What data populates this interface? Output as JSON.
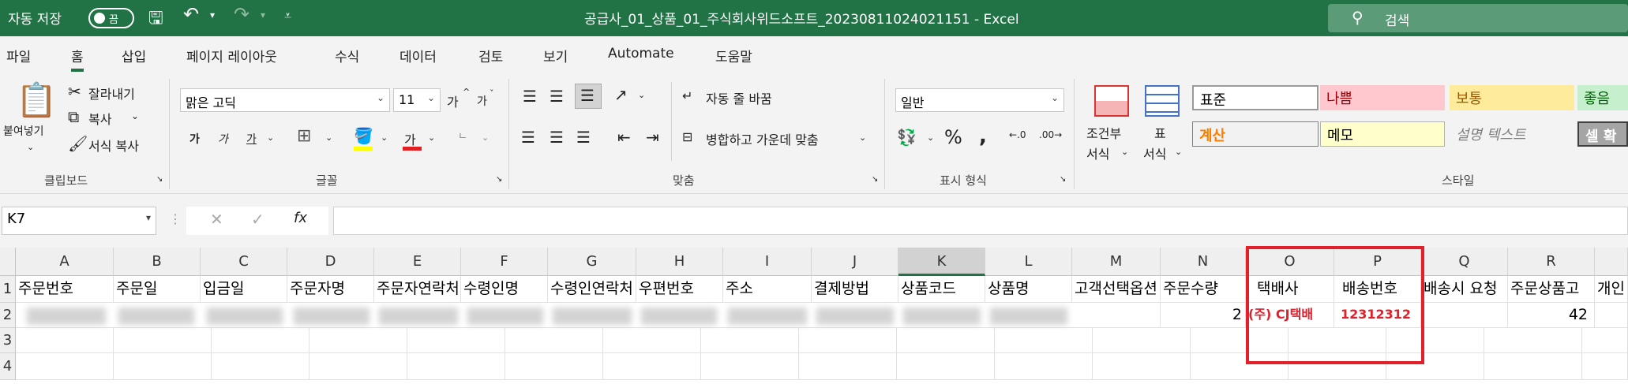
{
  "titlebar": {
    "autosave_label": "자동 저장",
    "autosave_state": "끔",
    "doc_title": "공급사_01_상품_01_주식회사위드소프트_20230811024021151  -  Excel",
    "search_label": "검색"
  },
  "tabs": [
    "파일",
    "홈",
    "삽입",
    "페이지 레이아웃",
    "수식",
    "데이터",
    "검토",
    "보기",
    "Automate",
    "도움말"
  ],
  "active_tab": "홈",
  "ribbon": {
    "clipboard": {
      "paste": "붙여넣기",
      "cut": "잘라내기",
      "copy": "복사",
      "format_painter": "서식 복사",
      "label": "클립보드"
    },
    "font": {
      "name": "맑은 고딕",
      "size": "11",
      "grow": "가",
      "shrink": "가",
      "bold": "가",
      "italic": "가",
      "underline": "가",
      "color_letter": "가",
      "label": "글꼴"
    },
    "alignment": {
      "wrap": "자동 줄 바꿈",
      "merge": "병합하고 가운데 맞춤",
      "label": "맞춤"
    },
    "number": {
      "format": "일반",
      "label": "표시 형식"
    },
    "styles": {
      "conditional_line1": "조건부",
      "conditional_line2": "서식",
      "table_line1": "표",
      "table_line2": "서식",
      "cells": [
        "표준",
        "나쁨",
        "보통",
        "좋음",
        "계산",
        "메모",
        "설명 텍스트",
        "셀 확"
      ],
      "label": "스타일"
    }
  },
  "formula_bar": {
    "name_box": "K7",
    "fx": "fx",
    "content": ""
  },
  "grid": {
    "columns": [
      "A",
      "B",
      "C",
      "D",
      "E",
      "F",
      "G",
      "H",
      "I",
      "J",
      "K",
      "L",
      "M",
      "N",
      "O",
      "P",
      "Q",
      "R",
      ""
    ],
    "selected_column": "K",
    "rows": [
      "1",
      "2",
      "3",
      "4"
    ],
    "headers": [
      "주문번호",
      "주문일",
      "입금일",
      "주문자명",
      "주문자연락처",
      "수령인명",
      "수령인연락처",
      "우편번호",
      "주소",
      "결제방법",
      "상품코드",
      "상품명",
      "고객선택옵션",
      "주문수량",
      "택배사",
      "배송번호",
      "배송시 요청",
      "주문상품고",
      "개인"
    ],
    "row2": {
      "quantity": "2",
      "courier": "(주) CJ택배",
      "tracking": "12312312",
      "product_code_total": "42"
    }
  },
  "colors": {
    "excel_green": "#217346",
    "highlight_red": "#e0202a"
  }
}
